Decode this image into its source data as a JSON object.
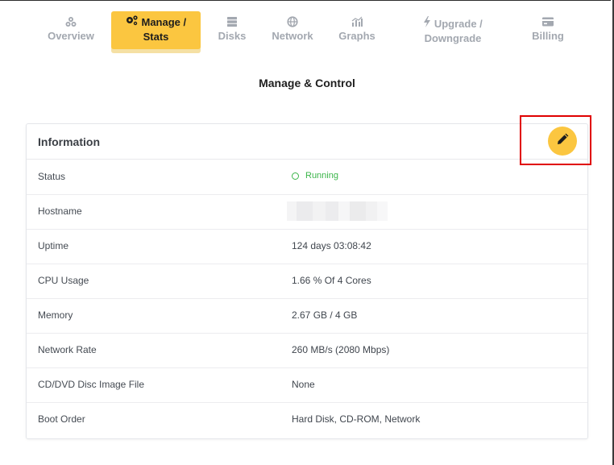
{
  "tabs": [
    {
      "label_1": "",
      "label_2": "Overview",
      "icon": "overview-icon",
      "active": false
    },
    {
      "label_1": "Manage /",
      "label_2": "Stats",
      "icon": "gears-icon",
      "active": true
    },
    {
      "label_1": "",
      "label_2": "Disks",
      "icon": "disk-icon",
      "active": false
    },
    {
      "label_1": "",
      "label_2": "Network",
      "icon": "globe-icon",
      "active": false
    },
    {
      "label_1": "",
      "label_2": "Graphs",
      "icon": "chart-icon",
      "active": false
    },
    {
      "label_1": "Upgrade /",
      "label_2": "Downgrade",
      "icon": "bolt-icon",
      "active": false
    },
    {
      "label_1": "",
      "label_2": "Billing",
      "icon": "card-icon",
      "active": false
    }
  ],
  "section_title": "Manage & Control",
  "card": {
    "header": "Information",
    "edit_icon": "pencil-icon",
    "rows": [
      {
        "key": "Status",
        "value": "Running"
      },
      {
        "key": "Hostname",
        "value": ""
      },
      {
        "key": "Uptime",
        "value": "124 days 03:08:42"
      },
      {
        "key": "CPU Usage",
        "value": "1.66 % Of 4 Cores"
      },
      {
        "key": "Memory",
        "value": "2.67 GB / 4 GB"
      },
      {
        "key": "Network Rate",
        "value": "260 MB/s (2080 Mbps)"
      },
      {
        "key": "CD/DVD Disc Image File",
        "value": "None"
      },
      {
        "key": "Boot Order",
        "value": "Hard Disk, CD-ROM, Network"
      }
    ]
  },
  "colors": {
    "accent": "#fbc640",
    "status_running": "#3bb54a",
    "highlight": "#e00000"
  }
}
